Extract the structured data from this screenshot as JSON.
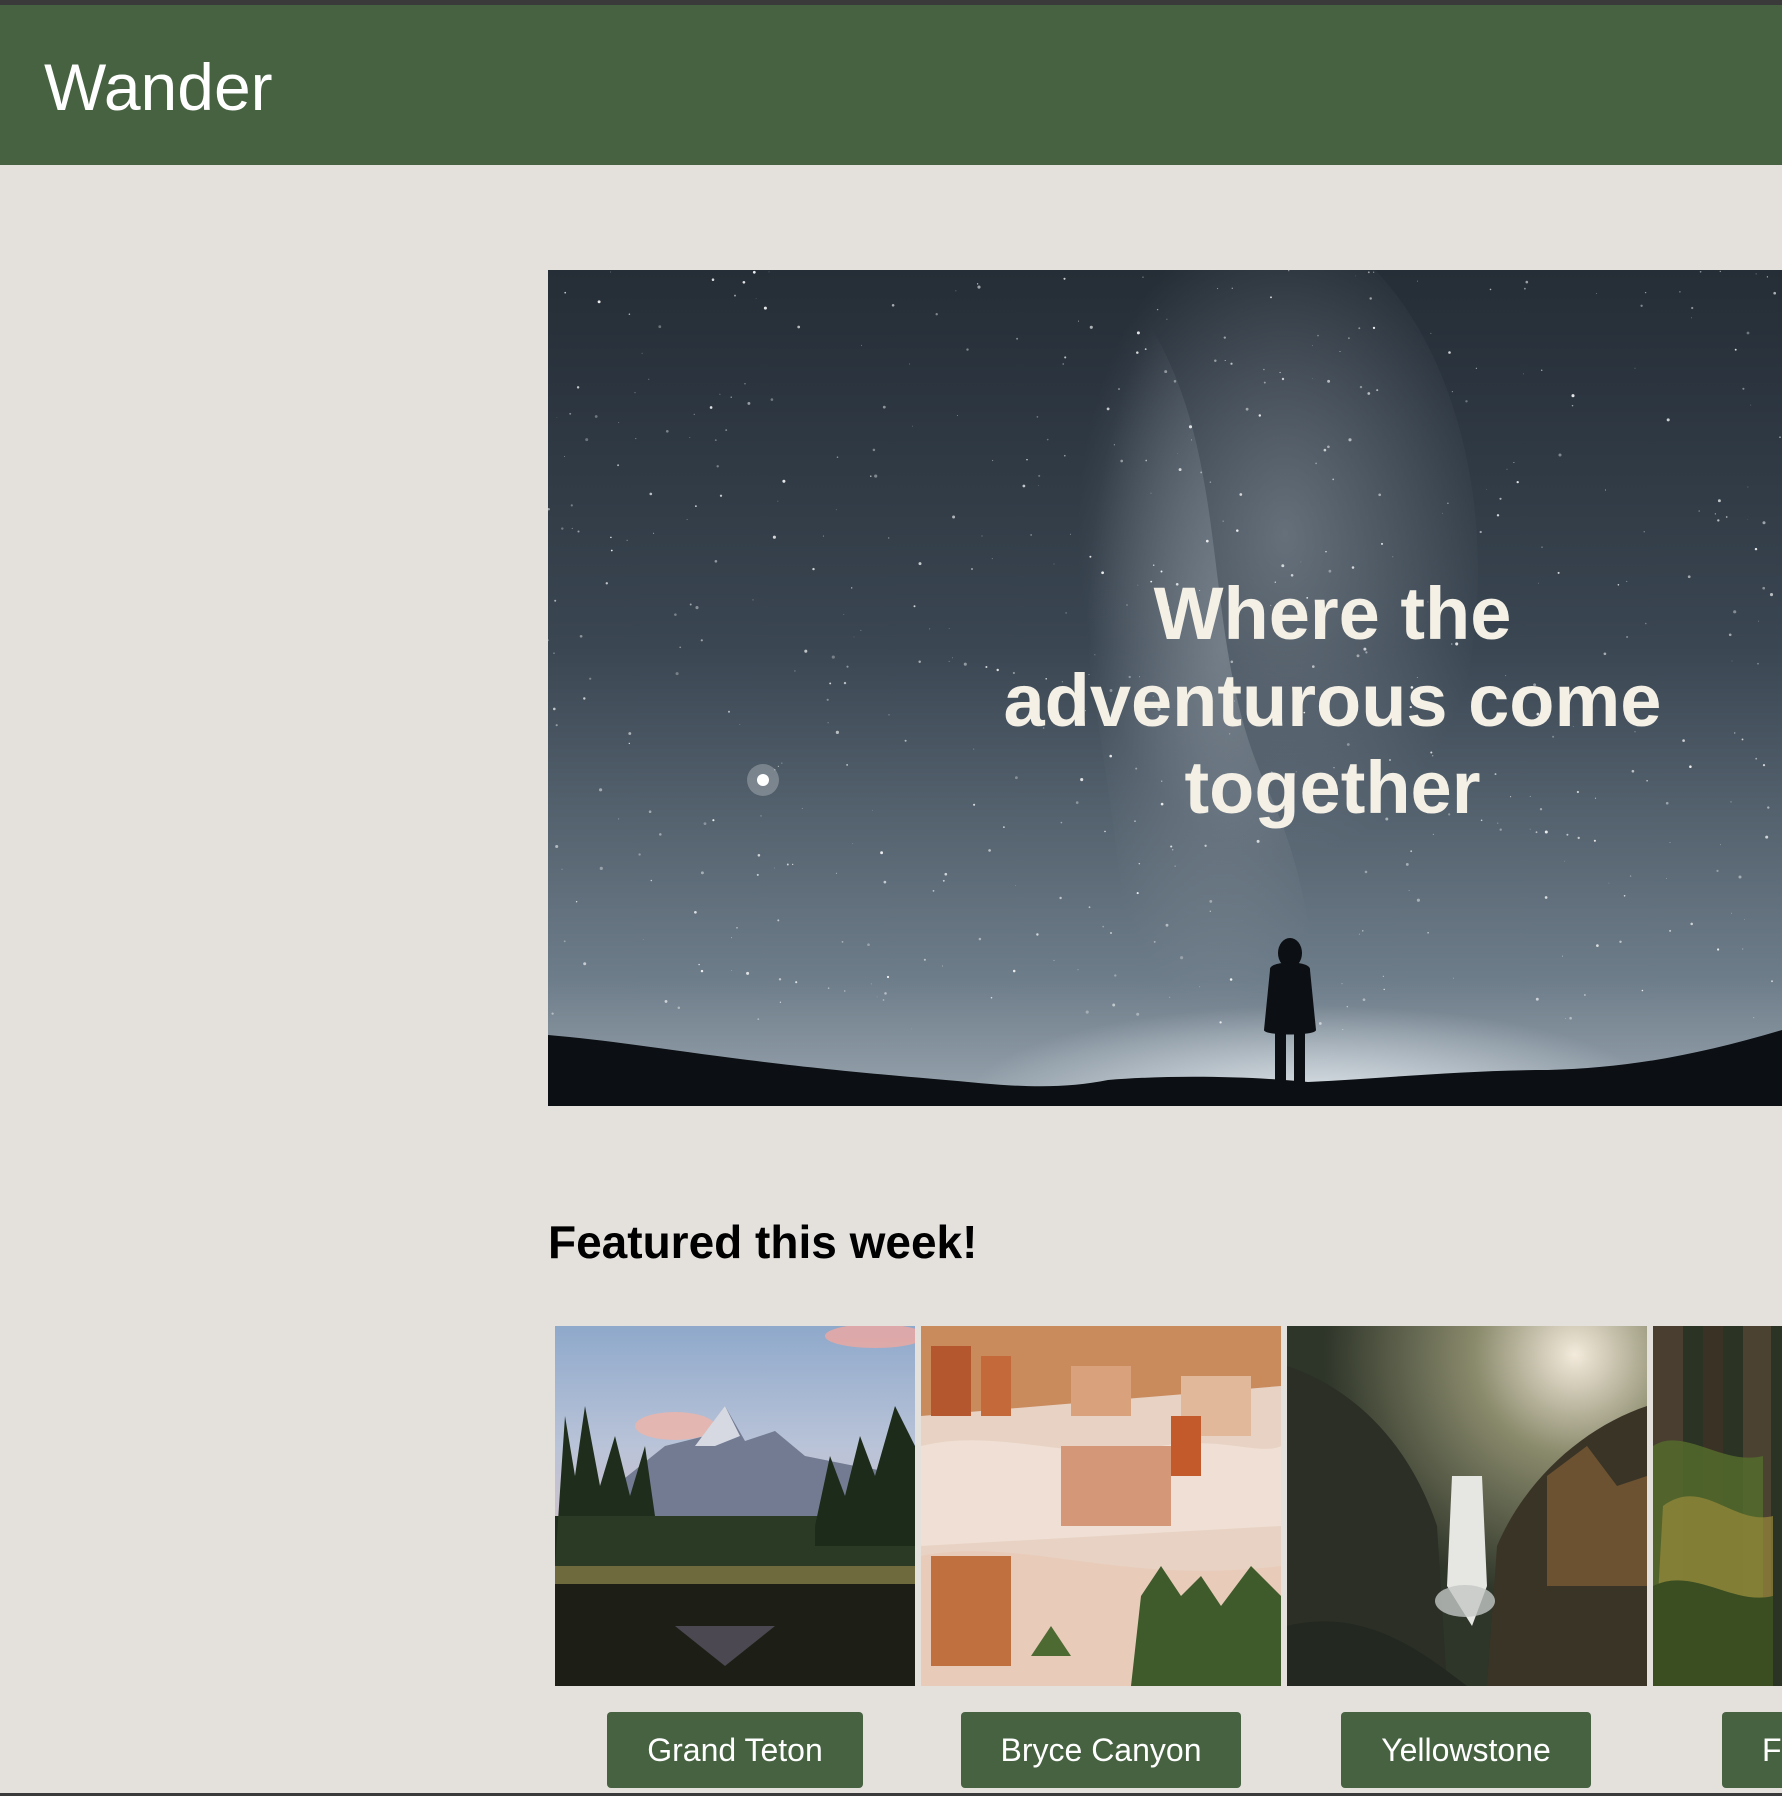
{
  "header": {
    "brand": "Wander",
    "background": "#466240"
  },
  "hero": {
    "title": "Where the adventurous come together",
    "image_icon": "night-sky-silhouette-image"
  },
  "featured": {
    "heading": "Featured this week!",
    "parks": [
      {
        "label": "Grand Teton",
        "image_icon": "mountain-lake-image"
      },
      {
        "label": "Bryce Canyon",
        "image_icon": "hoodoo-canyon-image"
      },
      {
        "label": "Yellowstone",
        "image_icon": "waterfall-canyon-image"
      },
      {
        "label": "F",
        "image_icon": "forest-image"
      }
    ]
  },
  "colors": {
    "page_background": "#e4e1dd",
    "accent": "#466240",
    "hero_text": "#f4f0e6"
  }
}
